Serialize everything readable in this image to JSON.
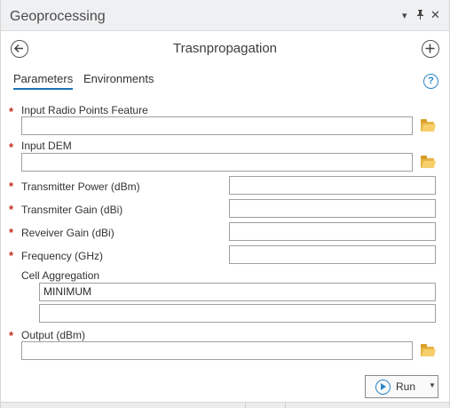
{
  "pane": {
    "title": "Geoprocessing"
  },
  "tool": {
    "title": "Trasnpropagation"
  },
  "tabs": {
    "parameters": "Parameters",
    "environments": "Environments"
  },
  "help": {
    "glyph": "?"
  },
  "required_marker": "*",
  "params": {
    "input_points": {
      "label": "Input Radio Points Feature",
      "value": ""
    },
    "input_dem": {
      "label": "Input DEM",
      "value": ""
    },
    "tx_power": {
      "label": "Transmitter Power (dBm)",
      "value": ""
    },
    "tx_gain": {
      "label": "Transmiter Gain (dBi)",
      "value": ""
    },
    "rx_gain": {
      "label": "Reveiver Gain (dBi)",
      "value": ""
    },
    "frequency": {
      "label": "Frequency (GHz)",
      "value": ""
    },
    "cell_agg": {
      "label": "Cell Aggregation",
      "value": "MINIMUM",
      "value2": ""
    },
    "output": {
      "label": "Output (dBm)",
      "value": ""
    }
  },
  "run": {
    "label": "Run"
  },
  "icons": {
    "dropdown": "chevron-down-icon",
    "pin": "pin-icon",
    "close": "close-icon",
    "back": "back-arrow-icon",
    "add": "add-icon",
    "help": "help-icon",
    "folder": "folder-icon",
    "run": "play-icon"
  },
  "colors": {
    "accent": "#1b73b4",
    "required": "#c62d1f",
    "folder": "#e7b443"
  }
}
